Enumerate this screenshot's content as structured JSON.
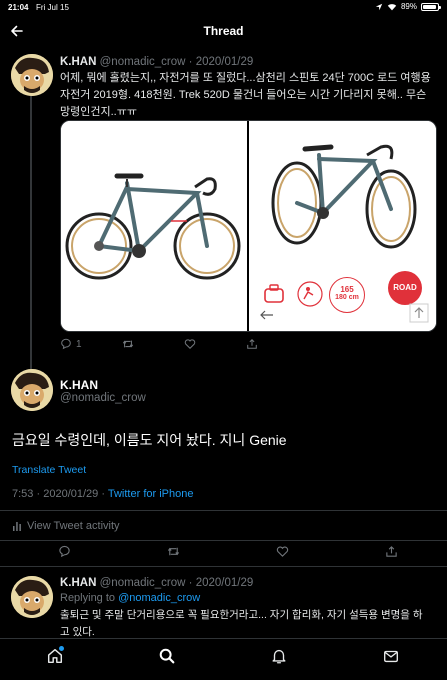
{
  "status_bar": {
    "time": "21:04",
    "date": "Fri Jul 15",
    "battery": "89%"
  },
  "nav": {
    "title": "Thread",
    "back_icon": "arrow-left-icon"
  },
  "tweet1": {
    "name": "K.HAN",
    "handle": "@nomadic_crow",
    "date": "2020/01/29",
    "text_lines": [
      "어제, 뭐에 홀렸는지,, 자전거를 또 질렀다...삼천리 스핀토 24단 700C 로드 여행용",
      "자전거 2019형. 418천원. Trek 520D 물건너 들어오는 시간 기다리지 못해.. 무슨",
      "망령인건지..ㅠㅠ"
    ],
    "image_right": {
      "size_value": "165",
      "size_range": "180 cm",
      "badge": "ROAD"
    },
    "actions": {
      "replies": "1",
      "retweets": "",
      "likes": ""
    }
  },
  "main": {
    "name": "K.HAN",
    "handle": "@nomadic_crow",
    "text": "금요일 수령인데, 이름도 지어 놨다. 지니 Genie",
    "translate": "Translate Tweet",
    "time": "7:53",
    "date": "2020/01/29",
    "separator": "·",
    "source": "Twitter for iPhone",
    "activity": "View Tweet activity"
  },
  "reply": {
    "name": "K.HAN",
    "handle": "@nomadic_crow",
    "date": "2020/01/29",
    "replying_label": "Replying to",
    "replying_to": "@nomadic_crow",
    "text_lines": [
      "출퇴근 및 주말 단거리용으로 꼭 필요한거라고... 자기 합리화, 자기 설득용 변명을 하",
      "고 있다."
    ]
  },
  "tabs": [
    "home-icon",
    "search-icon",
    "notifications-icon",
    "messages-icon"
  ],
  "colors": {
    "accent": "#1d9bf0",
    "muted": "#71767b",
    "badge": "#e0313a",
    "bike": "#4f6b73"
  }
}
